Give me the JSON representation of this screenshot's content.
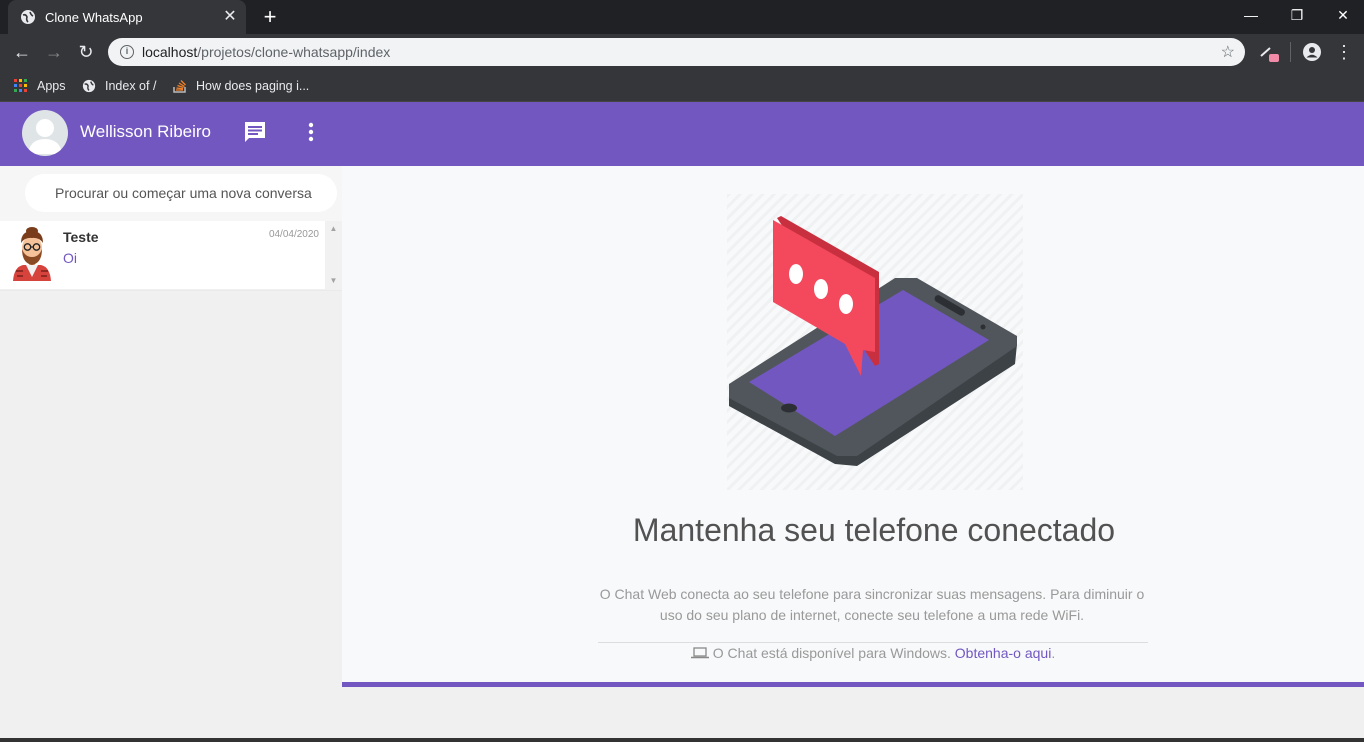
{
  "browser": {
    "tab_title": "Clone WhatsApp",
    "tab_icon": "globe-icon",
    "url_host": "localhost",
    "url_path": "/projetos/clone-whatsapp/index",
    "bookmarks": [
      {
        "label": "Apps",
        "icon": "apps-grid-icon"
      },
      {
        "label": "Index of /",
        "icon": "globe-icon"
      },
      {
        "label": "How does paging i...",
        "icon": "stackoverflow-icon"
      }
    ]
  },
  "header": {
    "user_name": "Wellisson Ribeiro",
    "accent_color": "#7257c1",
    "icons": [
      "new-chat-icon",
      "menu-dots-icon"
    ]
  },
  "search": {
    "placeholder": "Procurar ou começar uma nova conversa"
  },
  "chats": [
    {
      "name": "Teste",
      "date": "04/04/2020",
      "preview": "Oi"
    }
  ],
  "intro": {
    "title": "Mantenha seu telefone conectado",
    "description": "O Chat Web conecta ao seu telefone para sincronizar suas mensagens. Para diminuir o uso do seu plano de internet, conecte seu telefone a uma rede WiFi.",
    "windows_text": "O Chat está disponível para Windows.",
    "windows_link": "Obtenha-o aqui",
    "windows_suffix": "."
  },
  "colors": {
    "phone_screen": "#7257c1",
    "bubble": "#f4495c",
    "phone_body": "#3d4246"
  }
}
